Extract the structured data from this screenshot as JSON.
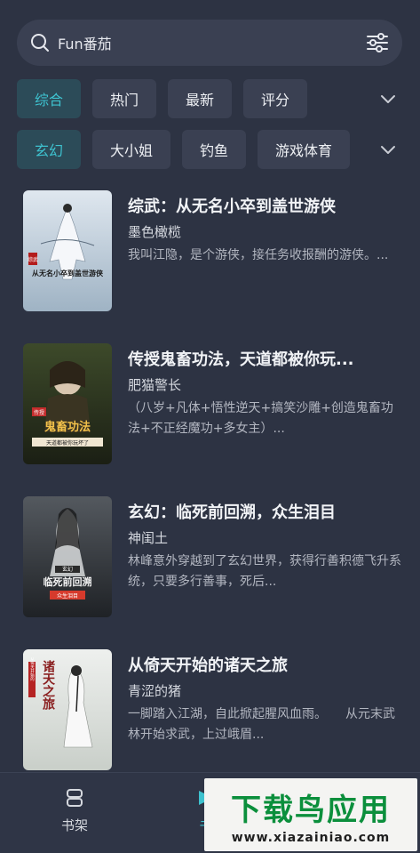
{
  "search": {
    "text": "Fun番茄"
  },
  "filters": {
    "row1": [
      "综合",
      "热门",
      "最新",
      "评分"
    ],
    "row2": [
      "玄幻",
      "大小姐",
      "钓鱼",
      "游戏体育"
    ]
  },
  "books": [
    {
      "title": "综武：从无名小卒到盖世游侠",
      "author": "墨色橄榄",
      "desc": "我叫江隐，是个游侠，接任务收报酬的游侠。...",
      "cover_text": "从无名小卒到盖世游侠",
      "cover_tag": "综武"
    },
    {
      "title": "传授鬼畜功法，天道都被你玩...",
      "author": "肥猫警长",
      "desc": "（八岁+凡体+悟性逆天+搞笑沙雕+创造鬼畜功法+不正经魔功+多女主）...",
      "cover_text": "鬼畜功法",
      "cover_tag": "传授",
      "cover_sub": "天道都被你玩坏了"
    },
    {
      "title": "玄幻：临死前回溯，众生泪目",
      "author": "神闺土",
      "desc": "林峰意外穿越到了玄幻世界，获得行善积德飞升系统，只要多行善事，死后...",
      "cover_text": "临死前回溯",
      "cover_tag": "玄幻",
      "cover_sub": "众生泪目"
    },
    {
      "title": "从倚天开始的诸天之旅",
      "author": "青涩的猪",
      "desc": "一脚踏入江湖，自此掀起腥风血雨。　　从元末武林开始求武，上过峨眉...",
      "cover_text": "诸天之旅",
      "cover_tag": "从倚天开始的"
    }
  ],
  "nav": {
    "shelf": "书架",
    "store": "书"
  },
  "watermark": {
    "big": "下载鸟应用",
    "small": "www.xiazainiao.com"
  },
  "colors": {
    "background": "#2d3343",
    "accent": "#3ec2cf",
    "chip": "#3a4052",
    "watermark_green": "#0b8f3c"
  }
}
